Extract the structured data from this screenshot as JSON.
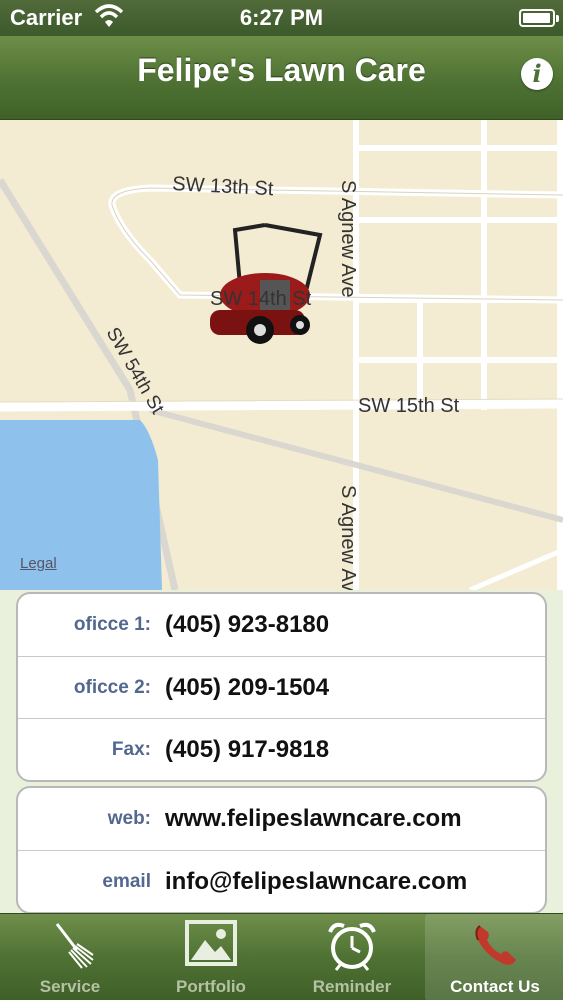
{
  "status_bar": {
    "carrier": "Carrier",
    "time": "6:27 PM",
    "battery_level": 0.95
  },
  "nav": {
    "title": "Felipe's Lawn Care",
    "info_icon": "info-icon"
  },
  "map": {
    "legal": "Legal",
    "streets": [
      "SW 13th St",
      "SW 54th St",
      "SW 14th St",
      "S Agnew Ave",
      "SW 15th St",
      "S Agnew Ave"
    ],
    "marker_icon": "lawn-mower-icon",
    "colors": {
      "land": "#f3ebd2",
      "water": "#8ec2ec",
      "road": "#ffffff"
    }
  },
  "contact": {
    "phones": [
      {
        "label": "oficce 1:",
        "value": "(405) 923-8180"
      },
      {
        "label": "oficce 2:",
        "value": "(405) 209-1504"
      },
      {
        "label": "Fax:",
        "value": "(405) 917-9818"
      }
    ],
    "online": [
      {
        "label": "web:",
        "value": "www.felipeslawncare.com"
      },
      {
        "label": "email",
        "value": "info@felipeslawncare.com"
      }
    ]
  },
  "tabs": [
    {
      "label": "Service",
      "icon": "rake-icon",
      "active": false
    },
    {
      "label": "Portfolio",
      "icon": "picture-icon",
      "active": false
    },
    {
      "label": "Reminder",
      "icon": "alarm-clock-icon",
      "active": false
    },
    {
      "label": "Contact Us",
      "icon": "phone-icon",
      "active": true
    }
  ],
  "colors": {
    "accent": "#4e7233",
    "label_blue": "#52688f",
    "background": "#e9f1dc"
  }
}
